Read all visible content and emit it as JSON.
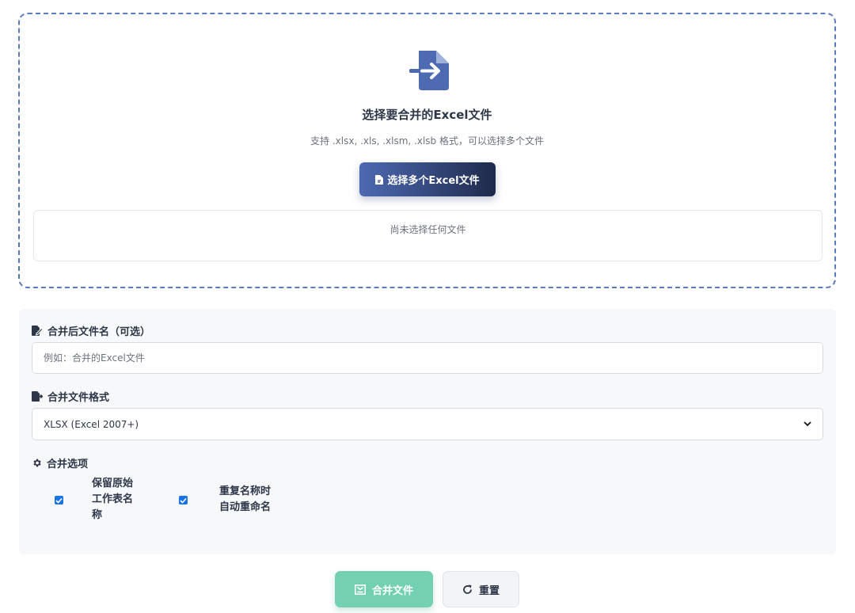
{
  "upload": {
    "icon": "file-import-icon",
    "title": "选择要合并的Excel文件",
    "hint": "支持 .xlsx, .xls, .xlsm, .xlsb 格式，可以选择多个文件",
    "select_button_label": "选择多个Excel文件",
    "select_button_icon": "file-icon",
    "empty_list_text": "尚未选择任何文件"
  },
  "options": {
    "filename_label": "合并后文件名（可选）",
    "filename_icon": "edit-file-icon",
    "filename_placeholder": "例如：合并的Excel文件",
    "format_label": "合并文件格式",
    "format_icon": "file-export-icon",
    "format_selected": "XLSX (Excel 2007+)",
    "merge_options_label": "合并选项",
    "merge_options_icon": "gear-icon",
    "checkbox_keep_sheet_names": {
      "label": "保留原始工作表名称",
      "checked": true
    },
    "checkbox_auto_rename": {
      "label": "重复名称时自动重命名",
      "checked": true
    }
  },
  "actions": {
    "merge_label": "合并文件",
    "merge_icon": "merge-icon",
    "reset_label": "重置",
    "reset_icon": "redo-icon"
  },
  "colors": {
    "dashed_border": "#5b7bbf",
    "primary_gradient_start": "#4d6ab3",
    "primary_gradient_end": "#1e2a4a",
    "merge_button": "#73d1b1",
    "checkbox": "#1a73e8"
  }
}
